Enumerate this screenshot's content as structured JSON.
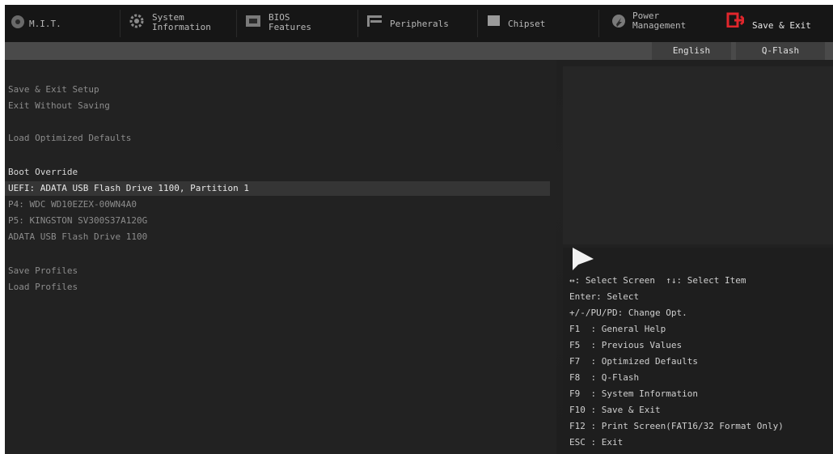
{
  "tabs": [
    {
      "label": "M.I.T.",
      "icon": "mit-icon"
    },
    {
      "label": "System\nInformation",
      "icon": "gear-icon"
    },
    {
      "label": "BIOS\nFeatures",
      "icon": "bios-icon"
    },
    {
      "label": "Peripherals",
      "icon": "peripherals-icon"
    },
    {
      "label": "Chipset",
      "icon": "chipset-icon"
    },
    {
      "label": "Power\nManagement",
      "icon": "power-icon"
    },
    {
      "label": "Save & Exit",
      "icon": "exit-icon"
    }
  ],
  "subbar": {
    "language": "English",
    "qflash": "Q-Flash"
  },
  "menu": {
    "save_exit_setup": "Save & Exit Setup",
    "exit_without_saving": "Exit Without Saving",
    "load_optimized_defaults": "Load Optimized Defaults",
    "boot_override": "Boot Override",
    "boot_items": [
      "UEFI: ADATA USB Flash Drive 1100, Partition 1",
      "P4: WDC WD10EZEX-00WN4A0",
      "P5: KINGSTON SV300S37A120G",
      "ADATA USB Flash Drive 1100"
    ],
    "save_profiles": "Save Profiles",
    "load_profiles": "Load Profiles"
  },
  "help": [
    "↔: Select Screen  ↑↓: Select Item",
    "Enter: Select",
    "+/-/PU/PD: Change Opt.",
    "F1  : General Help",
    "F5  : Previous Values",
    "F7  : Optimized Defaults",
    "F8  : Q-Flash",
    "F9  : System Information",
    "F10 : Save & Exit",
    "F12 : Print Screen(FAT16/32 Format Only)",
    "ESC : Exit"
  ],
  "colors": {
    "accent_active": "#e0262c",
    "background": "#222222"
  }
}
